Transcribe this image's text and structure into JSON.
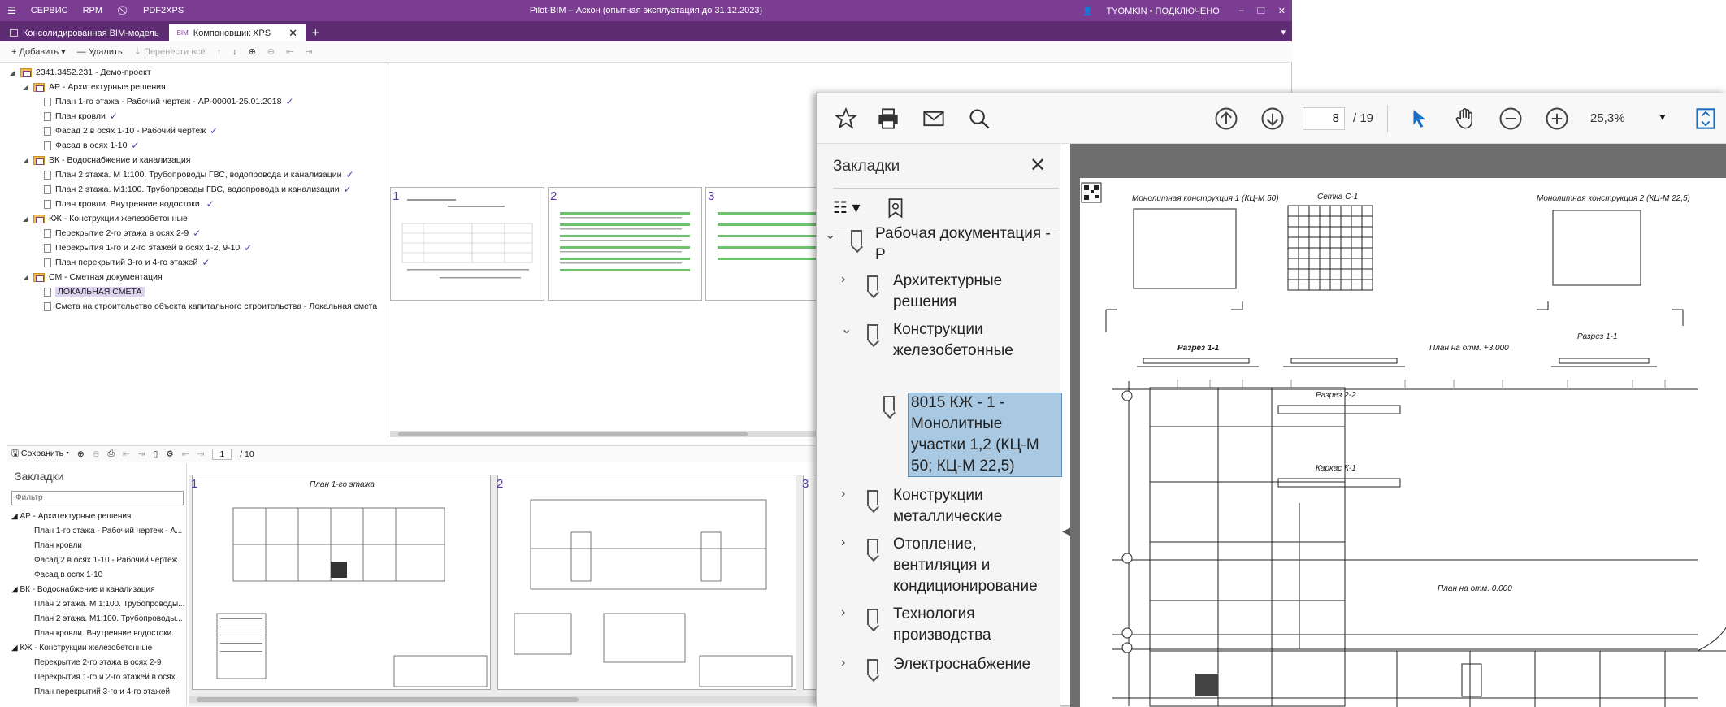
{
  "titlebar": {
    "menu": [
      "СЕРВИС",
      "RPM",
      "PDF2XPS"
    ],
    "title": "Pilot-BIM – Аскон (опытная эксплуатация до 31.12.2023)",
    "user": "TYOMKIN • ПОДКЛЮЧЕНО",
    "window_buttons": [
      "–",
      "❐",
      "✕"
    ]
  },
  "tabs": [
    {
      "label": "Консолидированная BIM-модель",
      "active": false
    },
    {
      "label": "Компоновщик XPS",
      "active": true,
      "close": "✕"
    }
  ],
  "tab_add": "+",
  "tab_menu": "▾",
  "toolbar": {
    "add": "Добавить",
    "delete": "Удалить",
    "move_all": "Перенести всё"
  },
  "tree": {
    "root": "2341.3452.231 - Демо-проект",
    "sections": [
      {
        "label": "АР - Архитектурные решения",
        "items": [
          "План 1-го этажа - Рабочий чертеж - АР-00001-25.01.2018",
          "План кровли",
          "Фасад 2 в осях 1-10 - Рабочий чертеж",
          "Фасад в осях 1-10"
        ]
      },
      {
        "label": "ВК - Водоснабжение и канализация",
        "items": [
          "План 2 этажа. М 1:100. Трубопроводы ГВС, водопровода и канализации",
          "План 2 этажа. М1:100. Трубопроводы ГВС, водопровода и канализации",
          "План кровли. Внутренние водостоки."
        ]
      },
      {
        "label": "КЖ - Конструкции железобетонные",
        "items": [
          "Перекрытие 2-го этажа в осях 2-9",
          "Перекрытия 1-го и 2-го этажей в осях 1-2, 9-10",
          "План перекрытий 3-го и 4-го этажей"
        ]
      },
      {
        "label": "СМ - Сметная документация",
        "items": [
          "ЛОКАЛЬНАЯ СМЕТА",
          "Смета на строительство объекта капитального строительства  - Локальная смета"
        ]
      }
    ]
  },
  "top_thumbs": [
    "1",
    "2",
    "3"
  ],
  "bottom_toolbar": {
    "save": "Сохранить",
    "page": "1",
    "total": "/ 10"
  },
  "bookmarks_left": {
    "title": "Закладки",
    "filter_placeholder": "Фильтр",
    "rows": [
      "АР - Архитектурные решения",
      "План 1-го этажа - Рабочий чертеж - А...",
      "План кровли",
      "Фасад 2 в осях 1-10 - Рабочий чертеж",
      "Фасад в осях 1-10",
      "ВК - Водоснабжение и канализация",
      "План 2 этажа. М 1:100. Трубопроводы...",
      "План 2 этажа. М1:100. Трубопроводы...",
      "План кровли. Внутренние водостоки.",
      "КЖ - Конструкции железобетонные",
      "Перекрытие 2-го этажа в осях 2-9",
      "Перекрытия 1-го и 2-го этажей в осях...",
      "План перекрытий 3-го и 4-го этажей"
    ]
  },
  "bottom_pages": [
    {
      "num": "1",
      "title": "План 1-го этажа"
    },
    {
      "num": "2",
      "title": ""
    },
    {
      "num": "3",
      "title": ""
    }
  ],
  "pdf": {
    "page": "8",
    "total": "/ 19",
    "zoom": "25,3%",
    "sidebar_title": "Закладки",
    "bookmarks": [
      {
        "lines": [
          "Рабочая документация -",
          "Р"
        ],
        "chevron": "⌄",
        "level": 0
      },
      {
        "lines": [
          "Архитектурные",
          "решения"
        ],
        "chevron": "›",
        "level": 1
      },
      {
        "lines": [
          "Конструкции",
          "железобетонные"
        ],
        "chevron": "⌄",
        "level": 1
      },
      {
        "lines": [
          "8015 КЖ - 1 -",
          "Монолитные",
          "участки 1,2 (КЦ-М",
          "50; КЦ-М 22,5)"
        ],
        "chevron": "",
        "level": 2,
        "selected": true
      },
      {
        "lines": [
          "Конструкции",
          "металлические"
        ],
        "chevron": "›",
        "level": 1
      },
      {
        "lines": [
          "Отопление,",
          "вентиляция и",
          "кондиционирование"
        ],
        "chevron": "›",
        "level": 1
      },
      {
        "lines": [
          "Технология",
          "производства"
        ],
        "chevron": "›",
        "level": 1
      },
      {
        "lines": [
          "Электроснабжение"
        ],
        "chevron": "›",
        "level": 1
      }
    ],
    "drawing": {
      "label1": "Монолитная конструкция 1 (КЦ-М 50)",
      "label2": "Сетка С-1",
      "label3": "Монолитная конструкция 2 (КЦ-М 22,5)",
      "section1": "Разрез 1-1",
      "section2": "Разрез 1-1",
      "section3": "Разрез 2-2",
      "karkas": "Каркас К-1",
      "plan1": "План на отм. +3.000",
      "plan2": "План на отм. 0.000"
    }
  },
  "colors": {
    "accent": "#7a3d91",
    "selection": "#a9c9e3"
  }
}
